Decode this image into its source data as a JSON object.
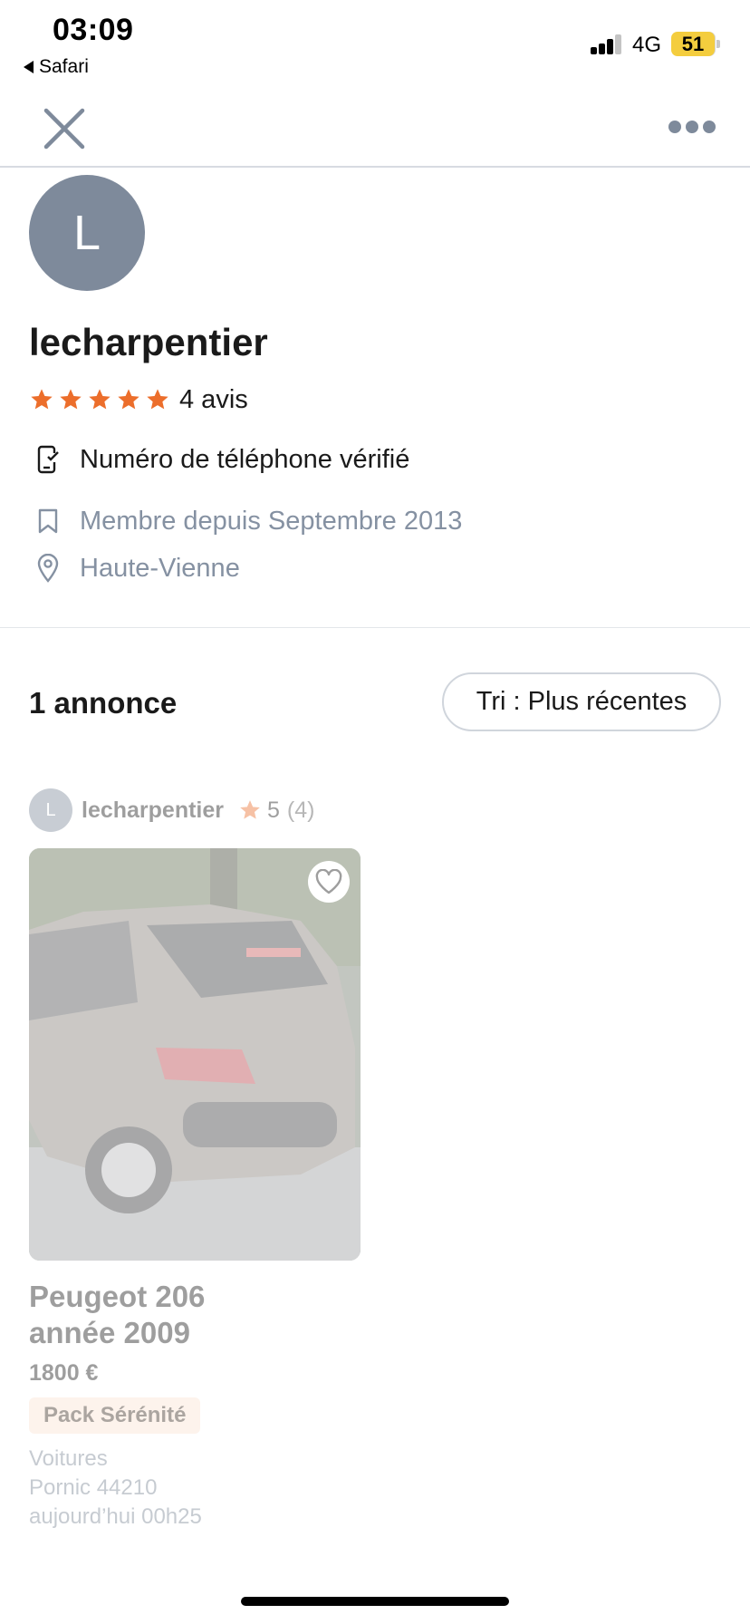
{
  "status_bar": {
    "time": "03:09",
    "back_app": "Safari",
    "network": "4G",
    "battery": "51",
    "battery_color": "#f4cd3e"
  },
  "nav": {
    "close_icon": "close-icon",
    "more_icon": "more-horizontal-icon"
  },
  "profile": {
    "avatar_letter": "L",
    "username": "lecharpentier",
    "stars": 5,
    "reviews": "4 avis",
    "phone_verified": "Numéro de téléphone vérifié",
    "member_since": "Membre depuis Septembre 2013",
    "location": "Haute-Vienne",
    "star_color": "#ec6e2b",
    "avatar_color": "#7e8a9b"
  },
  "listings_header": {
    "count": "1 annonce",
    "sort_label": "Tri : Plus récentes"
  },
  "listing": {
    "seller_avatar_letter": "L",
    "seller_name": "lecharpentier",
    "seller_score": "5",
    "seller_review_count": "(4)",
    "title": "Peugeot 206 année 2009",
    "title_line1": "Peugeot 206",
    "title_line2": "année 2009",
    "price": "1800 €",
    "badge": "Pack Sérénité",
    "category": "Voitures",
    "location": "Pornic 44210",
    "date": "aujourd’hui 00h25"
  }
}
